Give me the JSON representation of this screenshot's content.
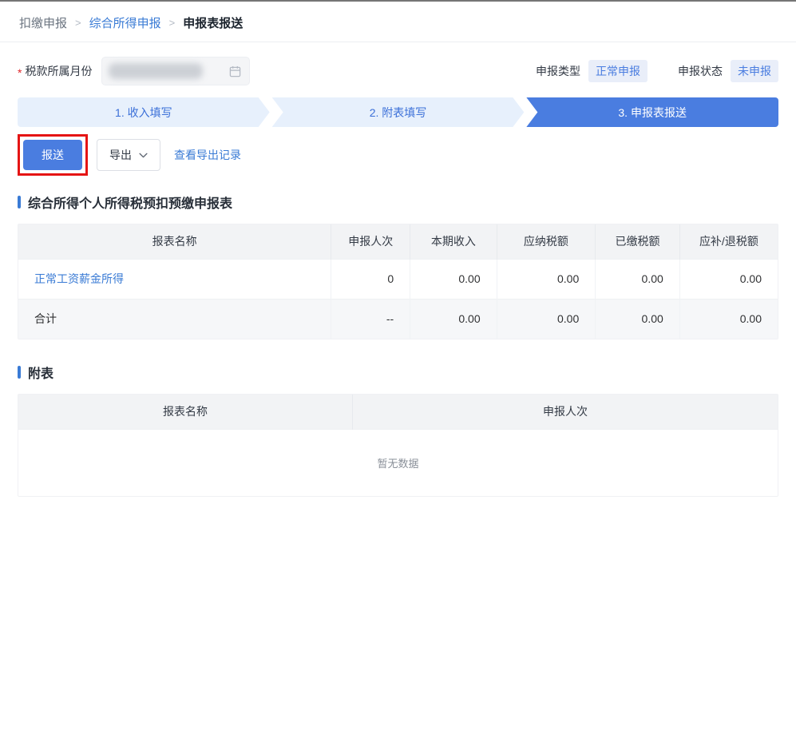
{
  "breadcrumb": {
    "separator": ">",
    "items": [
      {
        "label": "扣缴申报"
      },
      {
        "label": "综合所得申报"
      },
      {
        "label": "申报表报送"
      }
    ]
  },
  "filter": {
    "required_mark": "*",
    "label": "税款所属月份",
    "value_redacted": true
  },
  "meta": {
    "type_label": "申报类型",
    "type_value": "正常申报",
    "status_label": "申报状态",
    "status_value": "未申报"
  },
  "steps": [
    {
      "label": "1. 收入填写",
      "active": false
    },
    {
      "label": "2. 附表填写",
      "active": false
    },
    {
      "label": "3. 申报表报送",
      "active": true
    }
  ],
  "toolbar": {
    "submit_label": "报送",
    "export_label": "导出",
    "view_export_records_label": "查看导出记录"
  },
  "section_main": {
    "title": "综合所得个人所得税预扣预缴申报表"
  },
  "table_main": {
    "headers": [
      "报表名称",
      "申报人次",
      "本期收入",
      "应纳税额",
      "已缴税额",
      "应补/退税额"
    ],
    "rows": [
      {
        "name": "正常工资薪金所得",
        "is_link": true,
        "values": [
          "0",
          "0.00",
          "0.00",
          "0.00",
          "0.00"
        ]
      },
      {
        "name": "合计",
        "is_link": false,
        "values": [
          "--",
          "0.00",
          "0.00",
          "0.00",
          "0.00"
        ]
      }
    ]
  },
  "section_sub": {
    "title": "附表"
  },
  "table_sub": {
    "headers": [
      "报表名称",
      "申报人次"
    ],
    "empty_text": "暂无数据"
  },
  "colors": {
    "accent_blue": "#4a7de0",
    "link_blue": "#3a7bd5",
    "badge_bg": "#e9eef9",
    "step_inactive_bg": "#e7f0fc",
    "annotation_red": "#e51414",
    "header_gray": "#f2f3f5"
  }
}
